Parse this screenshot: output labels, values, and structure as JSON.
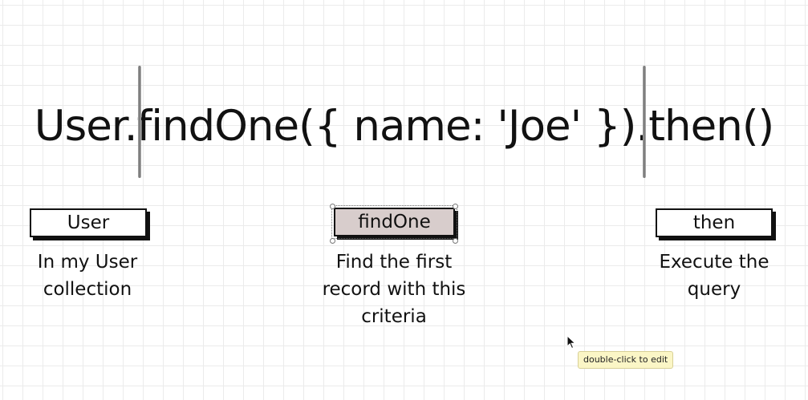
{
  "code": {
    "expression": "User.findOne({ name: 'Joe' }).then()"
  },
  "steps": [
    {
      "label": "User",
      "description_lines": [
        "In my User",
        "collection"
      ]
    },
    {
      "label": "findOne",
      "description_lines": [
        "Find the first",
        "record with this",
        "criteria"
      ]
    },
    {
      "label": "then",
      "description_lines": [
        "Execute the",
        "query"
      ]
    }
  ],
  "tooltip": {
    "text": "double-click to edit"
  },
  "colors": {
    "canvas_background": "#ffffff",
    "grid_line": "#ebebeb",
    "text": "#111111",
    "selected_box_fill": "#d8cdcc",
    "tooltip_background": "#fbf6c6"
  },
  "icons": {
    "pointer": "mouse-pointer-icon"
  }
}
